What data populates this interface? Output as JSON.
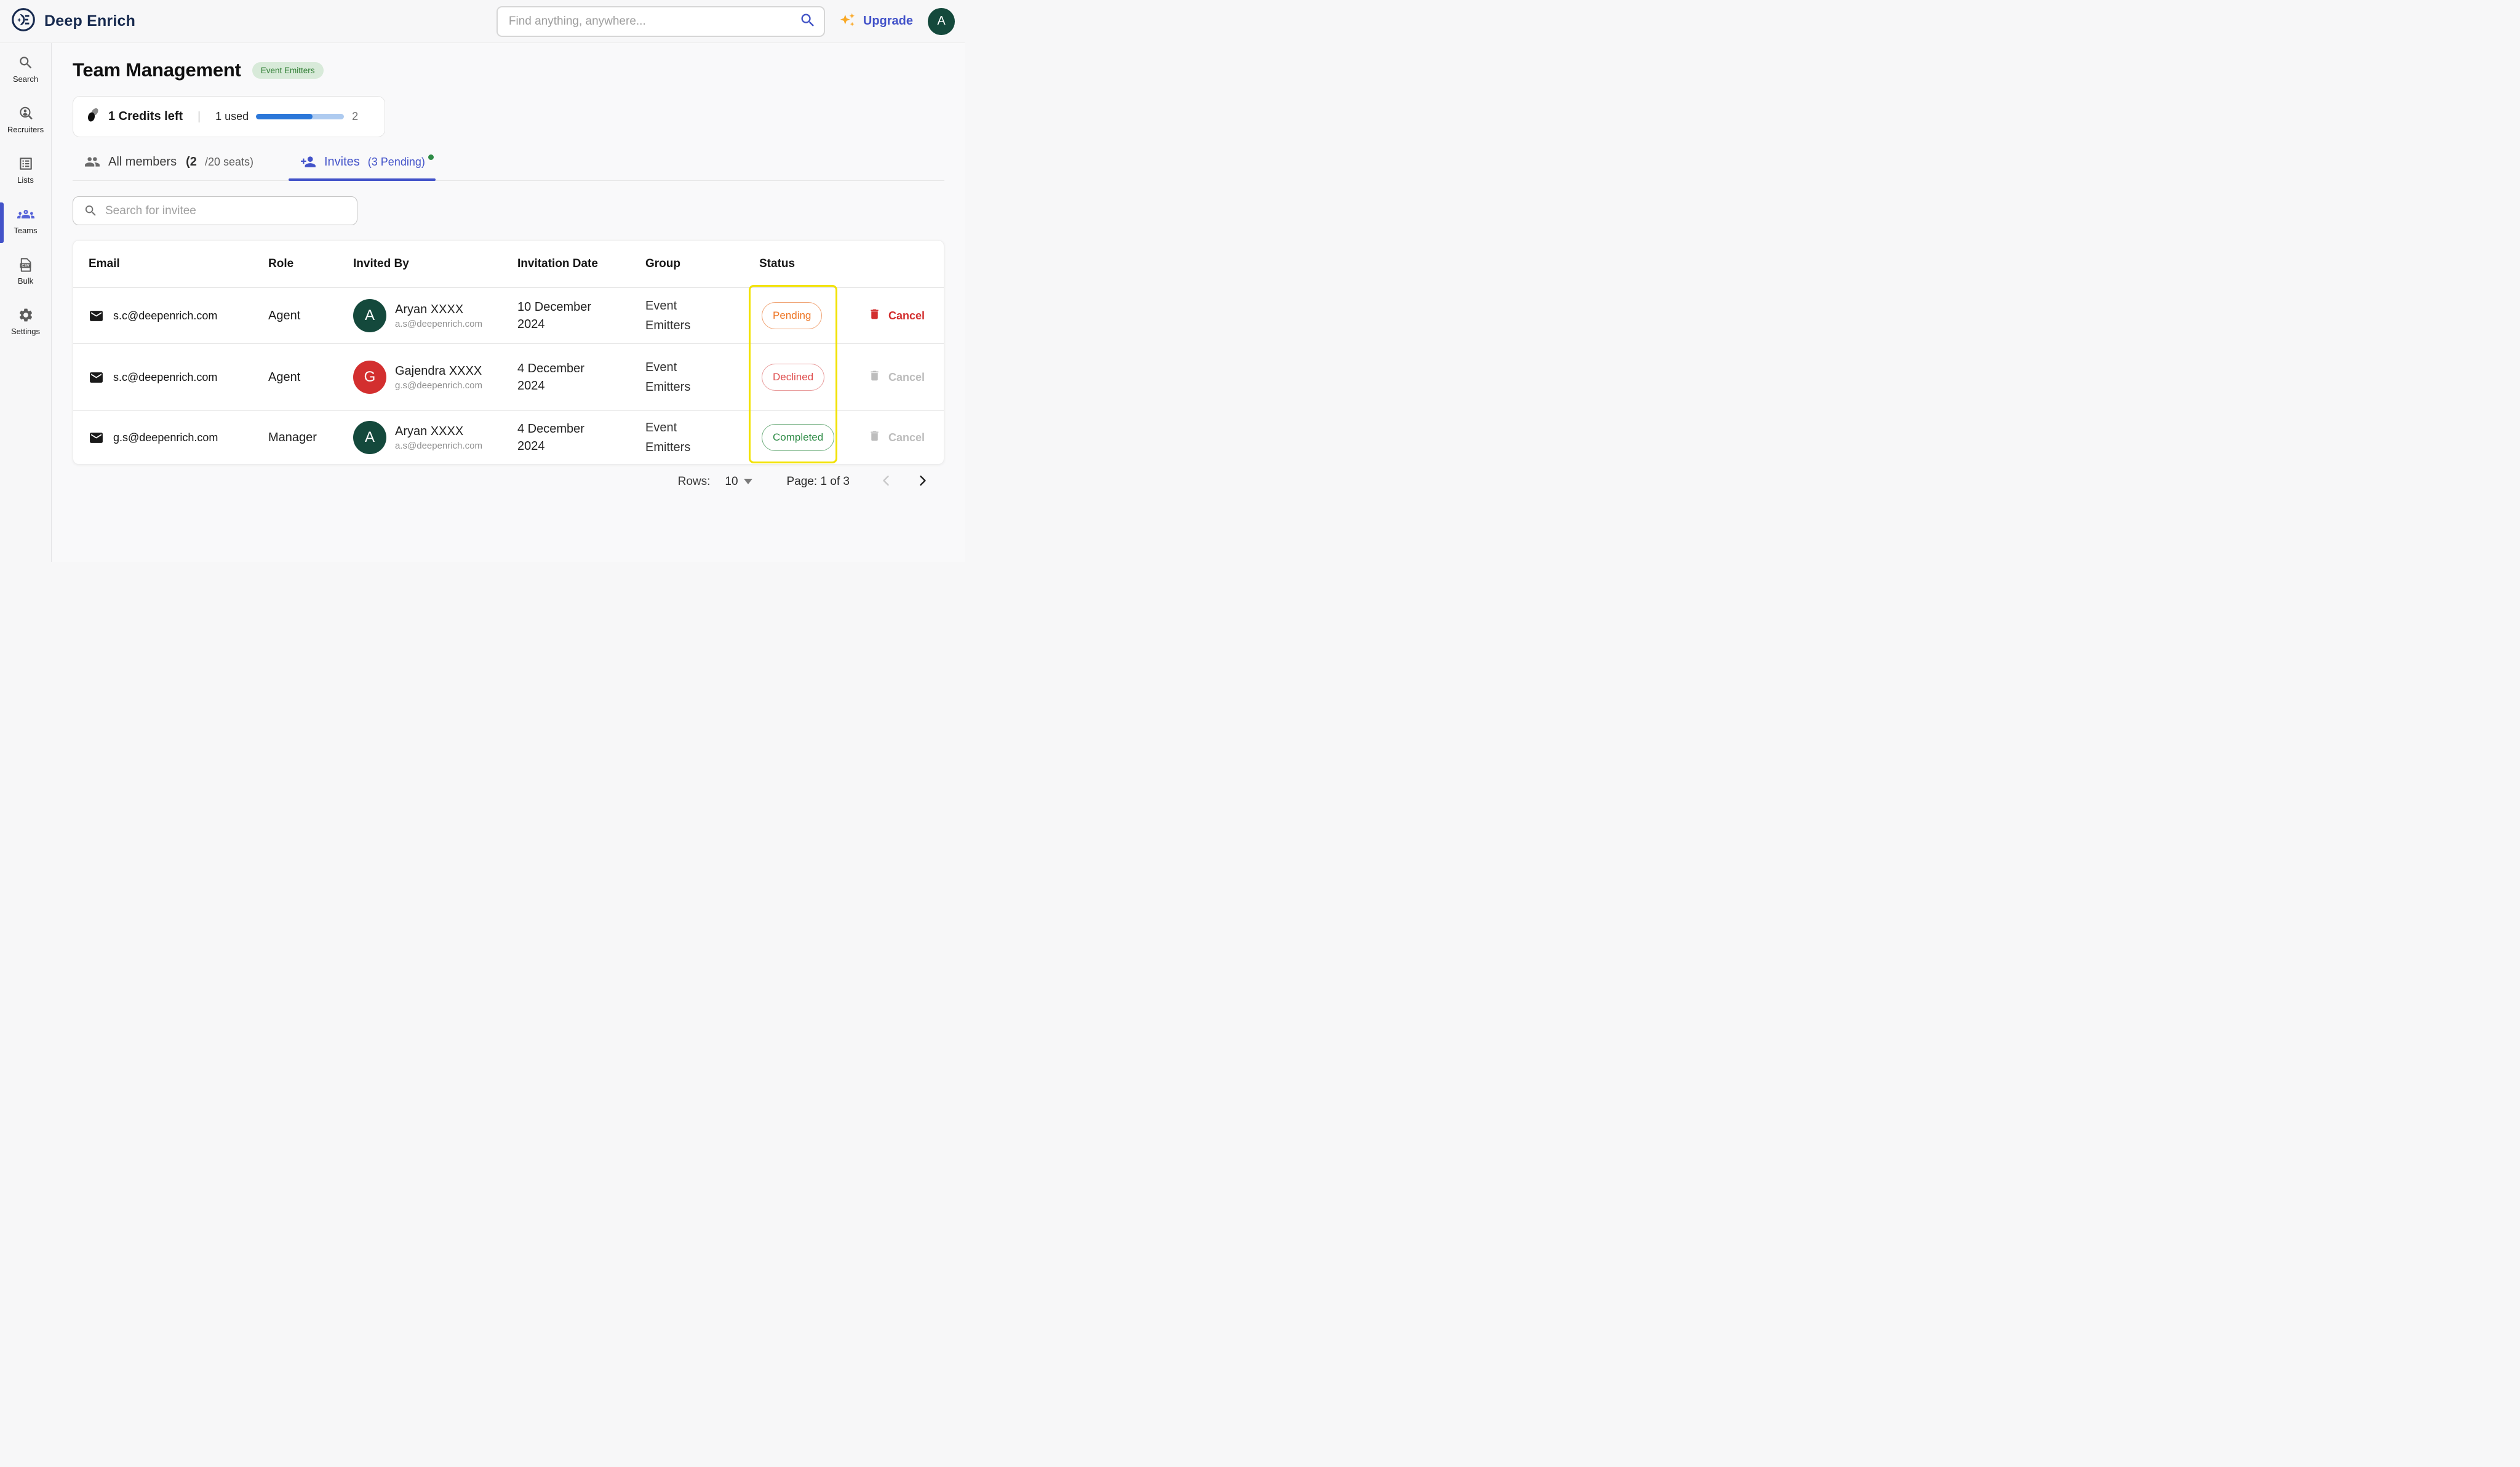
{
  "header": {
    "brand": "Deep Enrich",
    "search_placeholder": "Find anything, anywhere...",
    "upgrade_label": "Upgrade",
    "avatar_initial": "A"
  },
  "sidebar": {
    "items": [
      {
        "label": "Search"
      },
      {
        "label": "Recruiters"
      },
      {
        "label": "Lists"
      },
      {
        "label": "Teams",
        "active": true
      },
      {
        "label": "Bulk"
      },
      {
        "label": "Settings"
      }
    ]
  },
  "page": {
    "title": "Team Management",
    "badge": "Event Emitters"
  },
  "credits": {
    "left_text": "1 Credits left",
    "divider": "|",
    "used_text": "1 used",
    "total": "2",
    "used_fraction": 0.64,
    "fill_style": "width:64%"
  },
  "tabs": {
    "all_members": {
      "label": "All members",
      "seats_bold": "(2",
      "seats_rest": "/20 seats)"
    },
    "invites": {
      "label": "Invites",
      "suffix": "(3 Pending)",
      "active": true,
      "has_notification_dot": true
    }
  },
  "invitee_search": {
    "placeholder": "Search for invitee"
  },
  "table": {
    "columns": {
      "email": "Email",
      "role": "Role",
      "invited_by": "Invited By",
      "date": "Invitation Date",
      "group": "Group",
      "status": "Status"
    },
    "rows": [
      {
        "email": "s.c@deepenrich.com",
        "role": "Agent",
        "inviter_name": "Aryan XXXX",
        "inviter_email": "a.s@deepenrich.com",
        "avatar_initial": "A",
        "date": "10 December 2024",
        "group": "Event Emitters",
        "status": "Pending",
        "cancel_label": "Cancel",
        "cancel_enabled": true
      },
      {
        "email": "s.c@deepenrich.com",
        "role": "Agent",
        "inviter_name": "Gajendra XXXX",
        "inviter_email": "g.s@deepenrich.com",
        "avatar_initial": "G",
        "date": "4 December 2024",
        "group": "Event Emitters",
        "status": "Declined",
        "cancel_label": "Cancel",
        "cancel_enabled": false
      },
      {
        "email": "g.s@deepenrich.com",
        "role": "Manager",
        "inviter_name": "Aryan XXXX",
        "inviter_email": "a.s@deepenrich.com",
        "avatar_initial": "A",
        "date": "4 December 2024",
        "group": "Event Emitters",
        "status": "Completed",
        "cancel_label": "Cancel",
        "cancel_enabled": false
      }
    ]
  },
  "pagination": {
    "rows_label": "Rows:",
    "rows_value": "10",
    "page_label": "Page: 1 of 3"
  },
  "colors": {
    "brand_navy": "#16294E",
    "accent_blue": "#4353C9",
    "progress_blue": "#2B77D9",
    "progress_track": "#AECBF0",
    "badge_green_bg": "#D8EAD9",
    "badge_green_text": "#2E7D32",
    "notification_dot_green": "#2E8B46",
    "status_pending": "#EE7422",
    "status_declined": "#DF4F4F",
    "status_completed": "#2E8B46",
    "cancel_red": "#D32F2F",
    "cancel_disabled_gray": "#BDBDBD",
    "avatar_dark_green": "#14493C",
    "avatar_red": "#D32F2F",
    "annotation_yellow": "#F2E205",
    "upgrade_sparkle_orange": "#F9A825"
  }
}
